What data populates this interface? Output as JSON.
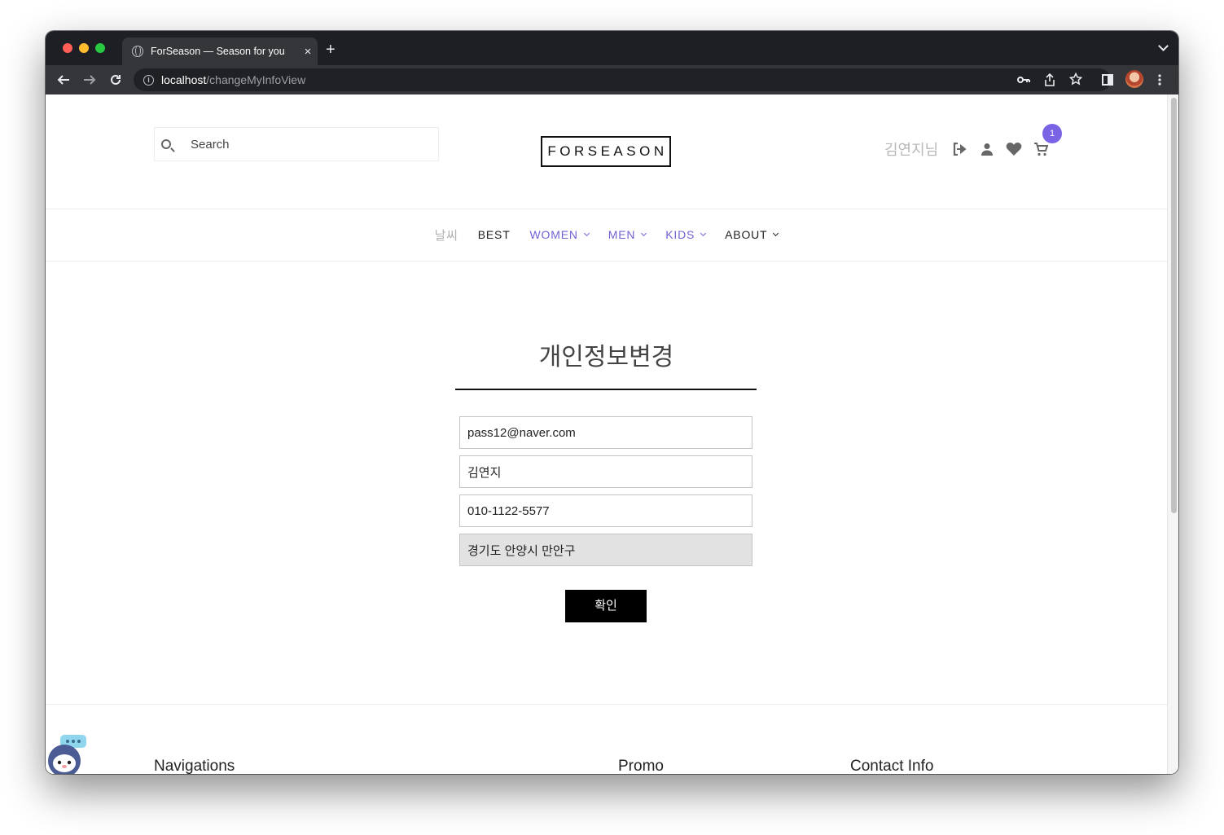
{
  "browser": {
    "tab_title": "ForSeason — Season for you",
    "tab_close": "×",
    "new_tab": "+",
    "url_host": "localhost",
    "url_path": "/changeMyInfoView"
  },
  "header": {
    "search_placeholder": "Search",
    "logo": "FORSEASON",
    "user_name": "김연지님",
    "cart_count": "1"
  },
  "nav": {
    "weather": "날씨",
    "items": [
      {
        "label": "BEST"
      },
      {
        "label": "WOMEN"
      },
      {
        "label": "MEN"
      },
      {
        "label": "KIDS"
      },
      {
        "label": "ABOUT"
      }
    ]
  },
  "form": {
    "title": "개인정보변경",
    "email": "pass12@naver.com",
    "name": "김연지",
    "phone": "010-1122-5577",
    "address": "경기도 안양시 만안구",
    "submit_label": "확인"
  },
  "footer": {
    "navigations": "Navigations",
    "promo": "Promo",
    "contact": "Contact Info"
  },
  "colors": {
    "accent": "#7b63e6",
    "menu_purple": "#6f63d4"
  }
}
